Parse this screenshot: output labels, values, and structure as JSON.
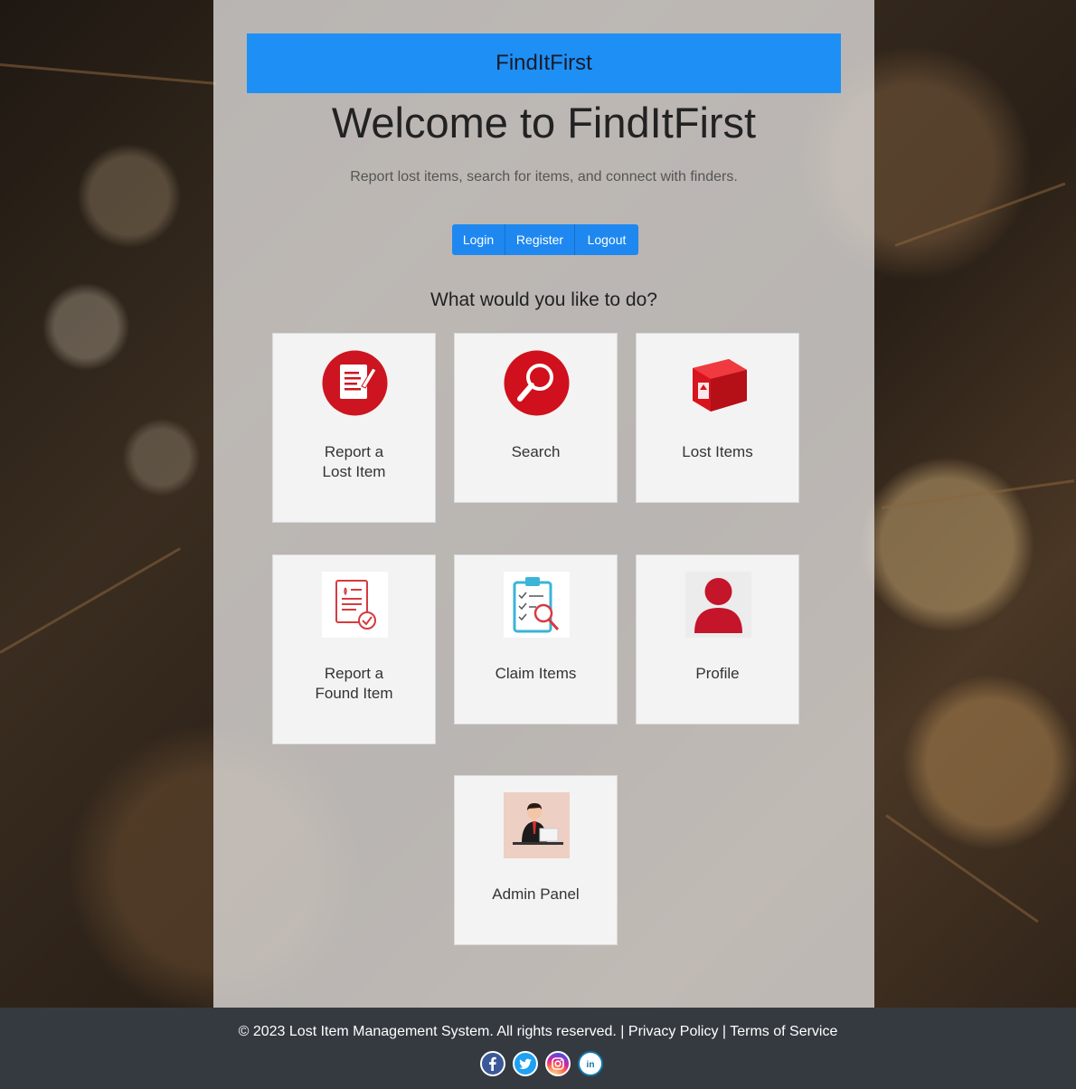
{
  "brand": {
    "name": "FindItFirst",
    "color": "#1e90f5"
  },
  "hero": {
    "title": "Welcome to FindItFirst",
    "subtitle": "Report lost items, search for items, and connect with finders."
  },
  "auth": {
    "login": "Login",
    "register": "Register",
    "logout": "Logout"
  },
  "question": "What would you like to do?",
  "actions": [
    {
      "label": "Report a\nLost Item",
      "icon": "report-lost-icon"
    },
    {
      "label": "Search",
      "icon": "search-icon"
    },
    {
      "label": "Lost Items",
      "icon": "box-icon"
    },
    {
      "label": "Report a\nFound Item",
      "icon": "report-found-icon"
    },
    {
      "label": "Claim Items",
      "icon": "clipboard-search-icon"
    },
    {
      "label": "Profile",
      "icon": "user-icon"
    },
    {
      "label": "Admin Panel",
      "icon": "admin-icon"
    }
  ],
  "footer": {
    "copyright": "© 2023 Lost Item Management System. All rights reserved.",
    "separator": "|",
    "privacy": "Privacy Policy",
    "terms": "Terms of Service",
    "socials": [
      "facebook-icon",
      "twitter-icon",
      "instagram-icon",
      "linkedin-icon"
    ]
  }
}
